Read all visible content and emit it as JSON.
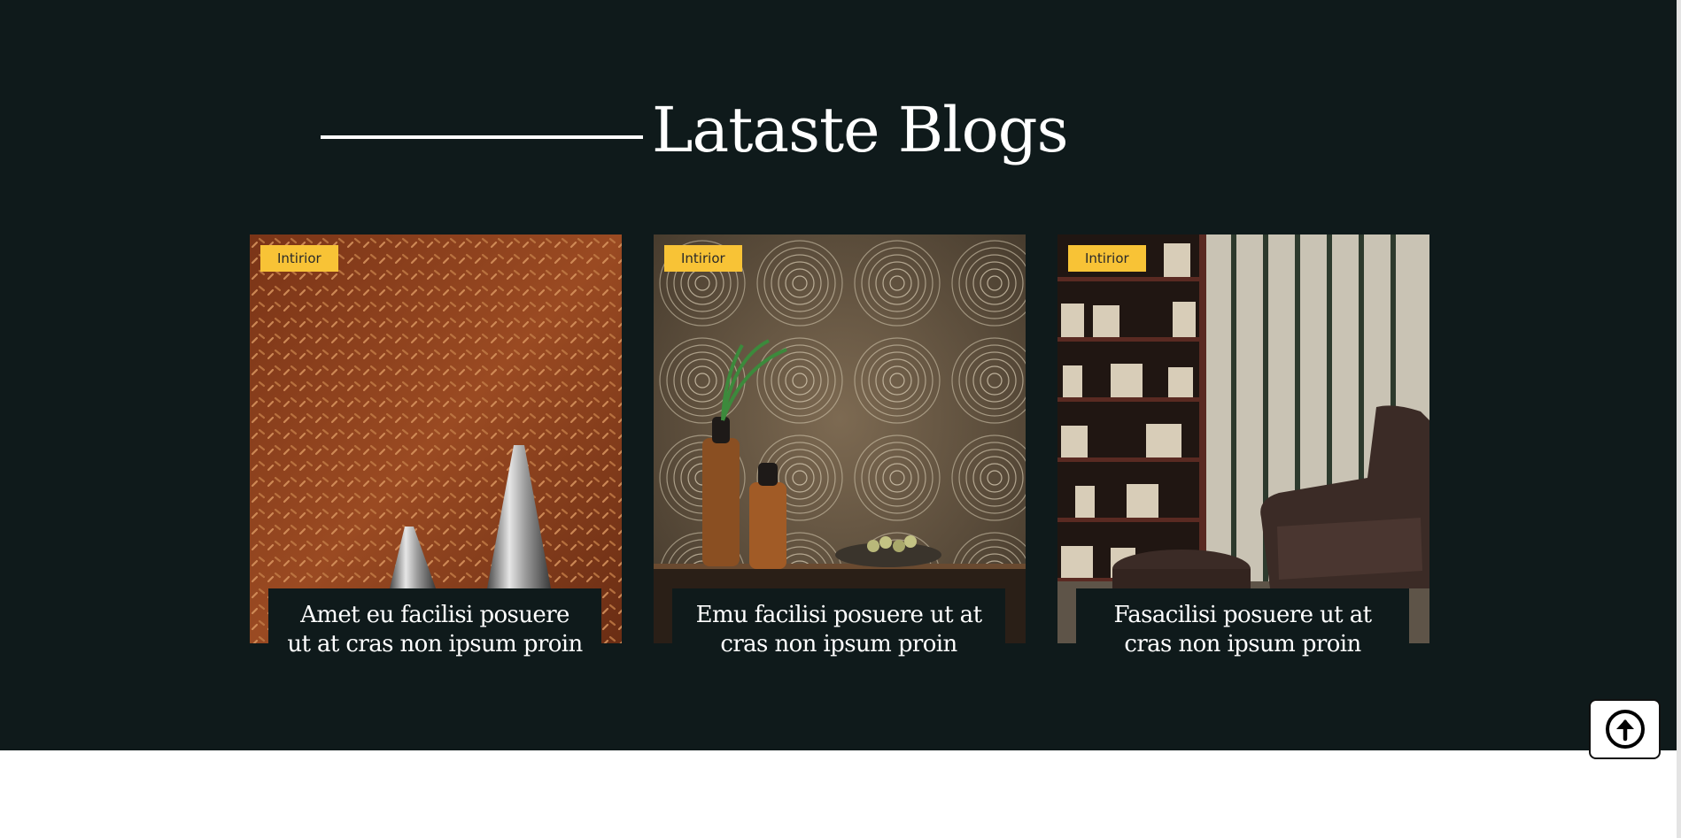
{
  "section": {
    "heading": "Lataste Blogs",
    "background_color": "#0f1a1b"
  },
  "blog_cards": [
    {
      "tag": "Intirior",
      "title_line1": "Amet eu facilisi posuere",
      "title_line2": "ut at cras non ipsum proin",
      "image": "copper-diamond-plate-wall-with-silver-vases"
    },
    {
      "tag": "Intirior",
      "title_line1": "Emu facilisi posuere ut at",
      "title_line2": "cras non ipsum proin",
      "image": "textured-metal-wall-with-vases-and-fruit-bowl"
    },
    {
      "tag": "Intirior",
      "title_line1": "Fasacilisi posuere ut at",
      "title_line2": "cras non ipsum proin",
      "image": "bookshelf-and-leather-armchair"
    }
  ],
  "colors": {
    "tag_background": "#f8c336",
    "text": "#ffffff"
  },
  "scroll_top_icon": "arrow-up-circle-icon"
}
